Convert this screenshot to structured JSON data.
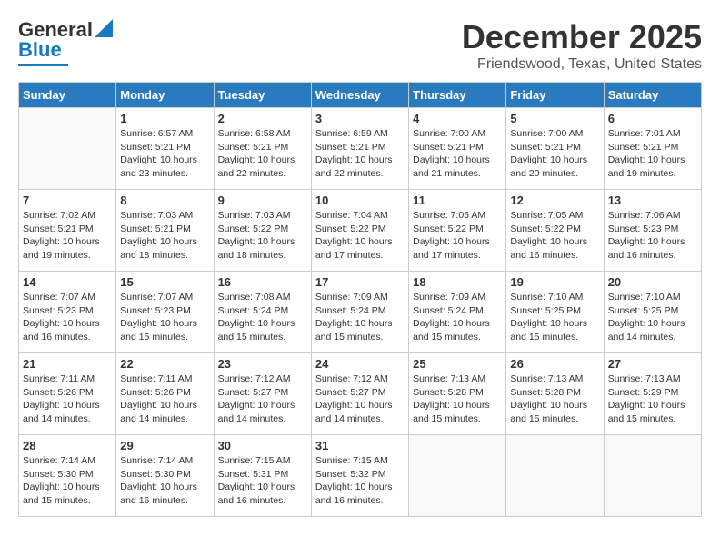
{
  "logo": {
    "general": "General",
    "blue": "Blue"
  },
  "header": {
    "month": "December 2025",
    "location": "Friendswood, Texas, United States"
  },
  "days_of_week": [
    "Sunday",
    "Monday",
    "Tuesday",
    "Wednesday",
    "Thursday",
    "Friday",
    "Saturday"
  ],
  "weeks": [
    [
      {
        "day": "",
        "info": ""
      },
      {
        "day": "1",
        "info": "Sunrise: 6:57 AM\nSunset: 5:21 PM\nDaylight: 10 hours\nand 23 minutes."
      },
      {
        "day": "2",
        "info": "Sunrise: 6:58 AM\nSunset: 5:21 PM\nDaylight: 10 hours\nand 22 minutes."
      },
      {
        "day": "3",
        "info": "Sunrise: 6:59 AM\nSunset: 5:21 PM\nDaylight: 10 hours\nand 22 minutes."
      },
      {
        "day": "4",
        "info": "Sunrise: 7:00 AM\nSunset: 5:21 PM\nDaylight: 10 hours\nand 21 minutes."
      },
      {
        "day": "5",
        "info": "Sunrise: 7:00 AM\nSunset: 5:21 PM\nDaylight: 10 hours\nand 20 minutes."
      },
      {
        "day": "6",
        "info": "Sunrise: 7:01 AM\nSunset: 5:21 PM\nDaylight: 10 hours\nand 19 minutes."
      }
    ],
    [
      {
        "day": "7",
        "info": "Sunrise: 7:02 AM\nSunset: 5:21 PM\nDaylight: 10 hours\nand 19 minutes."
      },
      {
        "day": "8",
        "info": "Sunrise: 7:03 AM\nSunset: 5:21 PM\nDaylight: 10 hours\nand 18 minutes."
      },
      {
        "day": "9",
        "info": "Sunrise: 7:03 AM\nSunset: 5:22 PM\nDaylight: 10 hours\nand 18 minutes."
      },
      {
        "day": "10",
        "info": "Sunrise: 7:04 AM\nSunset: 5:22 PM\nDaylight: 10 hours\nand 17 minutes."
      },
      {
        "day": "11",
        "info": "Sunrise: 7:05 AM\nSunset: 5:22 PM\nDaylight: 10 hours\nand 17 minutes."
      },
      {
        "day": "12",
        "info": "Sunrise: 7:05 AM\nSunset: 5:22 PM\nDaylight: 10 hours\nand 16 minutes."
      },
      {
        "day": "13",
        "info": "Sunrise: 7:06 AM\nSunset: 5:23 PM\nDaylight: 10 hours\nand 16 minutes."
      }
    ],
    [
      {
        "day": "14",
        "info": "Sunrise: 7:07 AM\nSunset: 5:23 PM\nDaylight: 10 hours\nand 16 minutes."
      },
      {
        "day": "15",
        "info": "Sunrise: 7:07 AM\nSunset: 5:23 PM\nDaylight: 10 hours\nand 15 minutes."
      },
      {
        "day": "16",
        "info": "Sunrise: 7:08 AM\nSunset: 5:24 PM\nDaylight: 10 hours\nand 15 minutes."
      },
      {
        "day": "17",
        "info": "Sunrise: 7:09 AM\nSunset: 5:24 PM\nDaylight: 10 hours\nand 15 minutes."
      },
      {
        "day": "18",
        "info": "Sunrise: 7:09 AM\nSunset: 5:24 PM\nDaylight: 10 hours\nand 15 minutes."
      },
      {
        "day": "19",
        "info": "Sunrise: 7:10 AM\nSunset: 5:25 PM\nDaylight: 10 hours\nand 15 minutes."
      },
      {
        "day": "20",
        "info": "Sunrise: 7:10 AM\nSunset: 5:25 PM\nDaylight: 10 hours\nand 14 minutes."
      }
    ],
    [
      {
        "day": "21",
        "info": "Sunrise: 7:11 AM\nSunset: 5:26 PM\nDaylight: 10 hours\nand 14 minutes."
      },
      {
        "day": "22",
        "info": "Sunrise: 7:11 AM\nSunset: 5:26 PM\nDaylight: 10 hours\nand 14 minutes."
      },
      {
        "day": "23",
        "info": "Sunrise: 7:12 AM\nSunset: 5:27 PM\nDaylight: 10 hours\nand 14 minutes."
      },
      {
        "day": "24",
        "info": "Sunrise: 7:12 AM\nSunset: 5:27 PM\nDaylight: 10 hours\nand 14 minutes."
      },
      {
        "day": "25",
        "info": "Sunrise: 7:13 AM\nSunset: 5:28 PM\nDaylight: 10 hours\nand 15 minutes."
      },
      {
        "day": "26",
        "info": "Sunrise: 7:13 AM\nSunset: 5:28 PM\nDaylight: 10 hours\nand 15 minutes."
      },
      {
        "day": "27",
        "info": "Sunrise: 7:13 AM\nSunset: 5:29 PM\nDaylight: 10 hours\nand 15 minutes."
      }
    ],
    [
      {
        "day": "28",
        "info": "Sunrise: 7:14 AM\nSunset: 5:30 PM\nDaylight: 10 hours\nand 15 minutes."
      },
      {
        "day": "29",
        "info": "Sunrise: 7:14 AM\nSunset: 5:30 PM\nDaylight: 10 hours\nand 16 minutes."
      },
      {
        "day": "30",
        "info": "Sunrise: 7:15 AM\nSunset: 5:31 PM\nDaylight: 10 hours\nand 16 minutes."
      },
      {
        "day": "31",
        "info": "Sunrise: 7:15 AM\nSunset: 5:32 PM\nDaylight: 10 hours\nand 16 minutes."
      },
      {
        "day": "",
        "info": ""
      },
      {
        "day": "",
        "info": ""
      },
      {
        "day": "",
        "info": ""
      }
    ]
  ]
}
